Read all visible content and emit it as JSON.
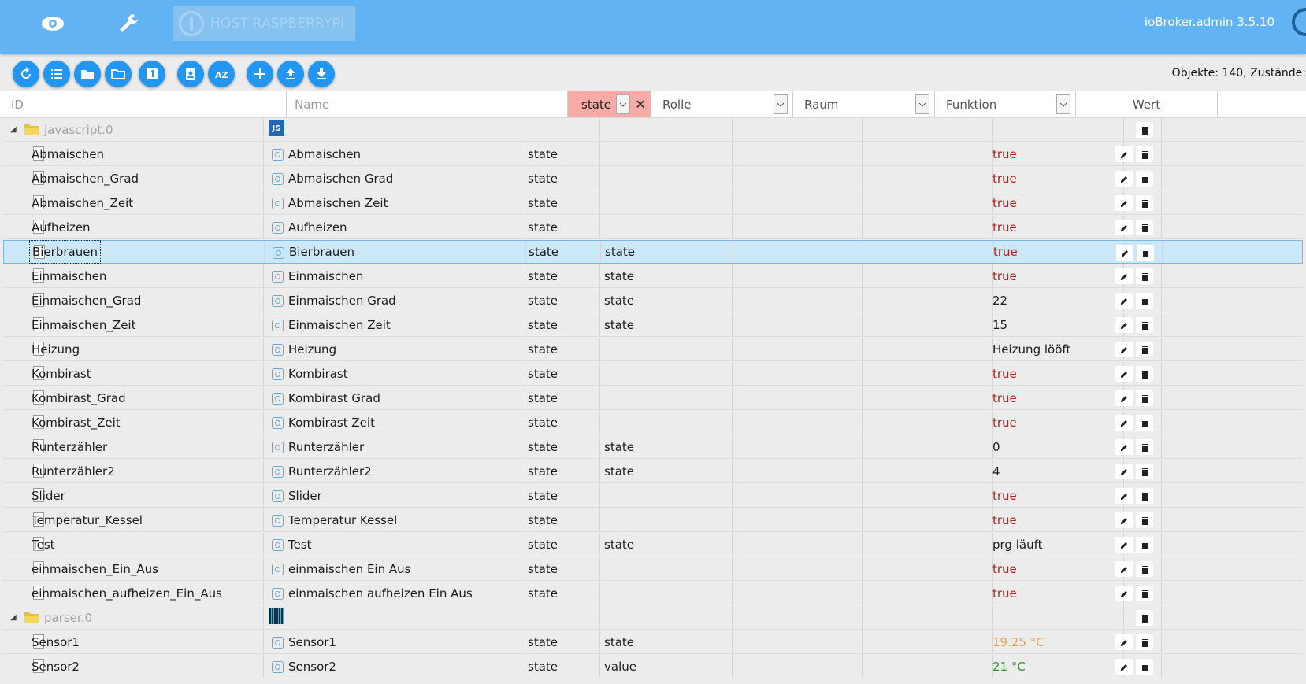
{
  "header": {
    "host_label": "HOST RASPBERRYPI",
    "version": "ioBroker.admin 3.5.10"
  },
  "toolbar": {
    "buttons": [
      "refresh-icon",
      "list-icon",
      "folder-closed-icon",
      "folder-open-icon",
      "number-one-icon",
      "clipboard-user-icon",
      "sort-az-icon",
      "add-icon",
      "upload-icon",
      "download-icon"
    ],
    "object_count": "Objekte: 140, Zustände:"
  },
  "filters": {
    "id_placeholder": "ID",
    "name_placeholder": "Name",
    "type_value": "state",
    "role_label": "Rolle",
    "room_label": "Raum",
    "function_label": "Funktion",
    "value_header": "Wert"
  },
  "rows": [
    {
      "kind": "group",
      "id": "javascript.0",
      "logo": "js"
    },
    {
      "kind": "state",
      "id": "Abmaischen",
      "name": "Abmaischen",
      "type": "state",
      "role": "",
      "value": "true",
      "vclass": "true"
    },
    {
      "kind": "state",
      "id": "Abmaischen_Grad",
      "name": "Abmaischen Grad",
      "type": "state",
      "role": "",
      "value": "true",
      "vclass": "true"
    },
    {
      "kind": "state",
      "id": "Abmaischen_Zeit",
      "name": "Abmaischen Zeit",
      "type": "state",
      "role": "",
      "value": "true",
      "vclass": "true"
    },
    {
      "kind": "state",
      "id": "Aufheizen",
      "name": "Aufheizen",
      "type": "state",
      "role": "",
      "value": "true",
      "vclass": "true"
    },
    {
      "kind": "state",
      "id": "Bierbrauen",
      "name": "Bierbrauen",
      "type": "state",
      "role": "state",
      "value": "true",
      "vclass": "true",
      "selected": true
    },
    {
      "kind": "state",
      "id": "Einmaischen",
      "name": "Einmaischen",
      "type": "state",
      "role": "state",
      "value": "true",
      "vclass": "true"
    },
    {
      "kind": "state",
      "id": "Einmaischen_Grad",
      "name": "Einmaischen Grad",
      "type": "state",
      "role": "state",
      "value": "22",
      "vclass": "plain"
    },
    {
      "kind": "state",
      "id": "Einmaischen_Zeit",
      "name": "Einmaischen Zeit",
      "type": "state",
      "role": "state",
      "value": "15",
      "vclass": "plain"
    },
    {
      "kind": "state",
      "id": "Heizung",
      "name": "Heizung",
      "type": "state",
      "role": "",
      "value": "Heizung lööft",
      "vclass": "plain"
    },
    {
      "kind": "state",
      "id": "Kombirast",
      "name": "Kombirast",
      "type": "state",
      "role": "",
      "value": "true",
      "vclass": "true"
    },
    {
      "kind": "state",
      "id": "Kombirast_Grad",
      "name": "Kombirast Grad",
      "type": "state",
      "role": "",
      "value": "true",
      "vclass": "true"
    },
    {
      "kind": "state",
      "id": "Kombirast_Zeit",
      "name": "Kombirast Zeit",
      "type": "state",
      "role": "",
      "value": "true",
      "vclass": "true"
    },
    {
      "kind": "state",
      "id": "Runterzähler",
      "name": "Runterzähler",
      "type": "state",
      "role": "state",
      "value": "0",
      "vclass": "plain"
    },
    {
      "kind": "state",
      "id": "Runterzähler2",
      "name": "Runterzähler2",
      "type": "state",
      "role": "state",
      "value": "4",
      "vclass": "plain"
    },
    {
      "kind": "state",
      "id": "Slider",
      "name": "Slider",
      "type": "state",
      "role": "",
      "value": "true",
      "vclass": "true"
    },
    {
      "kind": "state",
      "id": "Temperatur_Kessel",
      "name": "Temperatur Kessel",
      "type": "state",
      "role": "",
      "value": "true",
      "vclass": "true"
    },
    {
      "kind": "state",
      "id": "Test",
      "name": "Test",
      "type": "state",
      "role": "state",
      "value": "prg läuft",
      "vclass": "plain"
    },
    {
      "kind": "state",
      "id": "einmaischen_Ein_Aus",
      "name": "einmaischen Ein Aus",
      "type": "state",
      "role": "",
      "value": "true",
      "vclass": "true"
    },
    {
      "kind": "state",
      "id": "einmaischen_aufheizen_Ein_Aus",
      "name": "einmaischen aufheizen Ein Aus",
      "type": "state",
      "role": "",
      "value": "true",
      "vclass": "true"
    },
    {
      "kind": "group",
      "id": "parser.0",
      "logo": "parser"
    },
    {
      "kind": "state",
      "id": "Sensor1",
      "name": "Sensor1",
      "type": "state",
      "role": "state",
      "value": "19.25 °C",
      "vclass": "orange"
    },
    {
      "kind": "state",
      "id": "Sensor2",
      "name": "Sensor2",
      "type": "state",
      "role": "value",
      "value": "21 °C",
      "vclass": "green"
    }
  ]
}
